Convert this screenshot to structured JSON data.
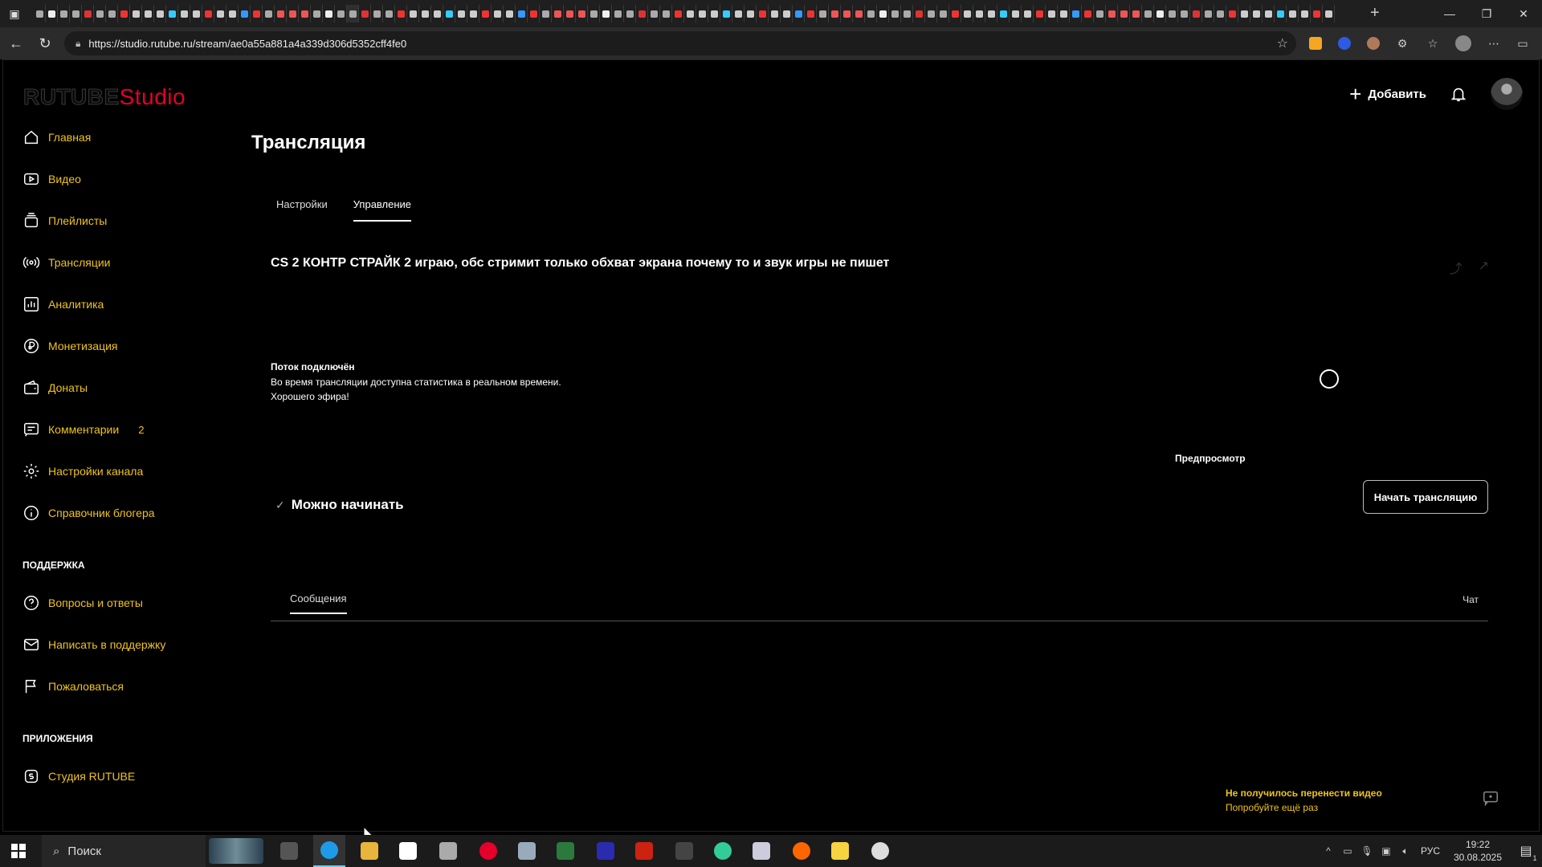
{
  "browser": {
    "url": "https://studio.rutube.ru/stream/ae0a55a881a4a339d306d5352cff4fe0"
  },
  "app": {
    "logo_main": "RUTUBE",
    "logo_studio": "Studio",
    "add_label": "Добавить",
    "brand_color": "#e4002b",
    "accent_color": "#f0c419"
  },
  "sidebar": {
    "items": [
      {
        "label": "Главная",
        "icon": "home-icon"
      },
      {
        "label": "Видео",
        "icon": "video-icon"
      },
      {
        "label": "Плейлисты",
        "icon": "playlist-icon"
      },
      {
        "label": "Трансляции",
        "icon": "broadcast-icon"
      },
      {
        "label": "Аналитика",
        "icon": "chart-icon"
      },
      {
        "label": "Монетизация",
        "icon": "ruble-icon"
      },
      {
        "label": "Донаты",
        "icon": "wallet-icon"
      },
      {
        "label": "Комментарии",
        "icon": "comment-icon",
        "count": "2"
      },
      {
        "label": "Настройки канала",
        "icon": "gear-icon"
      },
      {
        "label": "Справочник блогера",
        "icon": "info-icon"
      }
    ],
    "support_heading": "ПОДДЕРЖКА",
    "support_items": [
      {
        "label": "Вопросы и ответы",
        "icon": "question-icon"
      },
      {
        "label": "Написать в поддержку",
        "icon": "mail-icon"
      },
      {
        "label": "Пожаловаться",
        "icon": "flag-icon"
      }
    ],
    "apps_heading": "ПРИЛОЖЕНИЯ",
    "apps_items": [
      {
        "label": "Студия RUTUBE",
        "icon": "studio-app-icon"
      }
    ]
  },
  "main": {
    "page_title": "Трансляция",
    "tabs": [
      {
        "label": "Настройки",
        "active": false
      },
      {
        "label": "Управление",
        "active": true
      }
    ],
    "stream_title": "CS 2 КОНТР СТРАЙК 2 играю, обс стримит только обхват экрана почему то и звук игры не пишет",
    "status_title": "Поток подключён",
    "status_line1": "Во время трансляции доступна статистика в реальном времени.",
    "status_line2": "Хорошего эфира!",
    "preview_label": "Предпросмотр",
    "ready_label": "Можно начинать",
    "start_button": "Начать трансляцию",
    "messages_tab": "Сообщения",
    "chat_label": "Чат",
    "error_title": "Не получилось перенести видео",
    "error_retry": "Попробуйте ещё раз"
  },
  "taskbar": {
    "search_label": "Поиск",
    "lang": "РУС",
    "time": "19:22",
    "date": "30.08.2025",
    "notif_count": "1"
  }
}
